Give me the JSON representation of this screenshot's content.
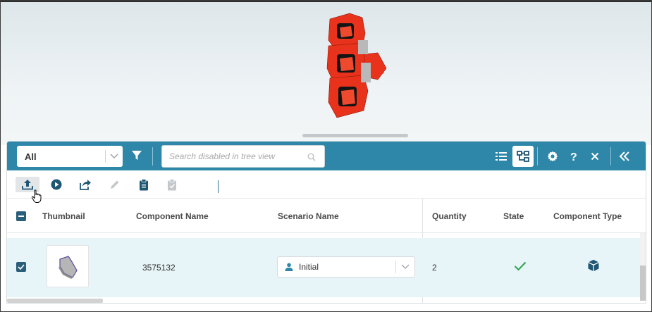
{
  "filter": {
    "selected": "All"
  },
  "search": {
    "placeholder": "Search disabled in tree view"
  },
  "columns": {
    "thumbnail": "Thumbnail",
    "component_name": "Component Name",
    "scenario_name": "Scenario Name",
    "quantity": "Quantity",
    "state": "State",
    "component_type": "Component Type"
  },
  "rows": [
    {
      "component_name": "3575132",
      "scenario": "Initial",
      "quantity": "2",
      "state": "check-icon",
      "component_type": "cube-icon"
    }
  ],
  "colors": {
    "header": "#2e87a8",
    "model": "#e8321c",
    "row_selected": "#e7f4f8",
    "check": "#2aa44a",
    "dark_accent": "#1f5673"
  }
}
